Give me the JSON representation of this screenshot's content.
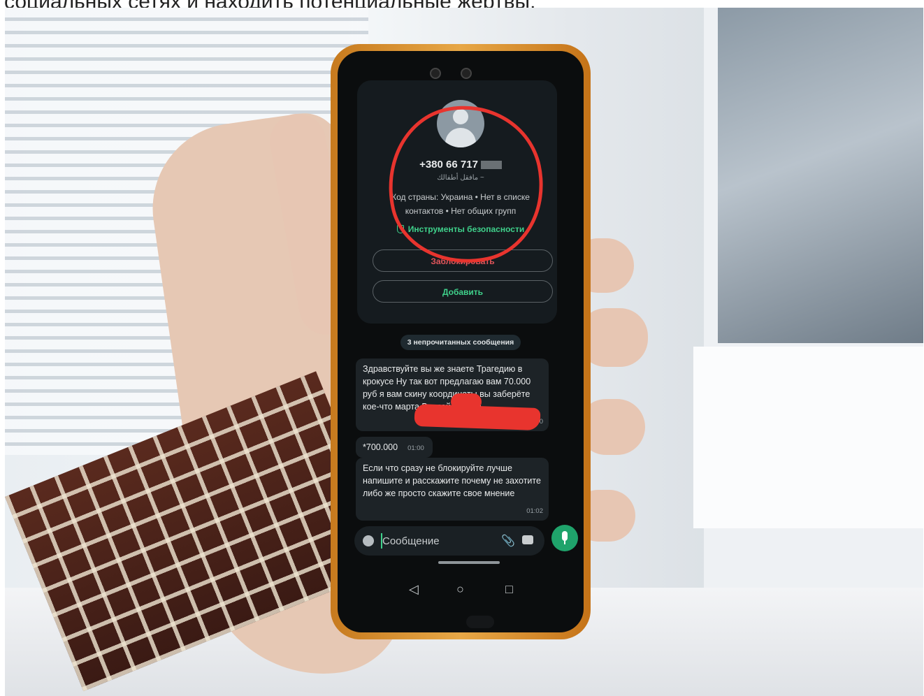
{
  "caption": "социальных сетях и находить потенциальные жертвы.",
  "contact": {
    "number": "+380 66 717",
    "push_name": "~ مافقل أطفالك",
    "info_line1": "Код страны: Украина • Нет в списке",
    "info_line2": "контактов • Нет общих групп",
    "security_tools": "Инструменты безопасности",
    "block_label": "Заблокировать",
    "add_label": "Добавить"
  },
  "unread_label": "3 непрочитанных сообщения",
  "messages": [
    {
      "text": "Здравствуйте вы же знаете Трагедию в крокусе Ну так вот предлагаю вам 70.000 руб я вам скину координаты вы заберёте кое-что марта Вы пойдёте на",
      "time": "01:00"
    },
    {
      "text": "*700.000",
      "time": "01:00"
    },
    {
      "text": "Если что сразу не блокируйте лучше напишите и расскажите почему не захотите либо же просто скажите свое мнение",
      "time": "01:02"
    }
  ],
  "composer": {
    "placeholder": "Сообщение"
  },
  "icons": {
    "emoji": "emoji-icon",
    "attach": "paperclip-icon",
    "camera": "camera-icon",
    "mic": "microphone-icon",
    "back": "back-icon",
    "home": "home-icon",
    "recents": "recents-icon"
  },
  "colors": {
    "accent": "#3fd18b",
    "danger": "#e0555a",
    "annotation": "#e8342e",
    "phone_frame": "#e7a746"
  }
}
